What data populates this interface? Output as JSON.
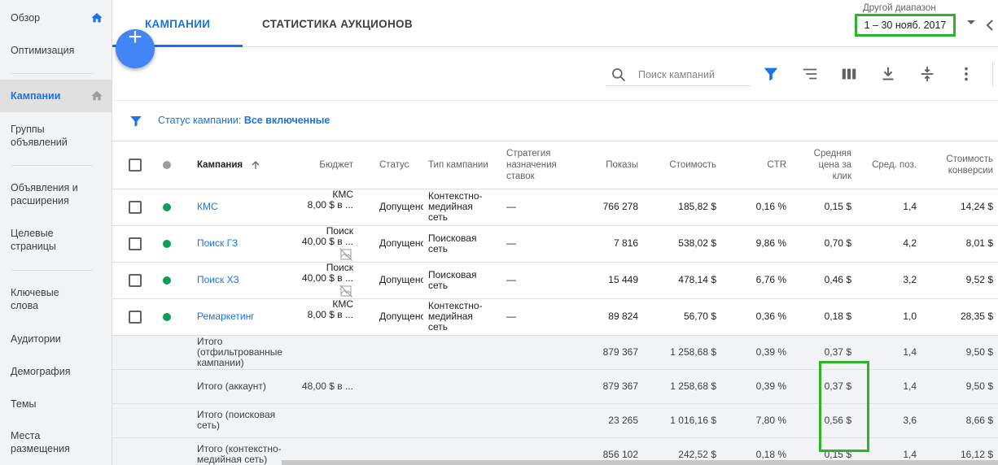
{
  "sidebar": {
    "items": [
      {
        "label": "Обзор"
      },
      {
        "label": "Оптимизация"
      },
      {
        "label": "Кампании"
      },
      {
        "label": "Группы объявлений"
      },
      {
        "label": "Объявления и расширения"
      },
      {
        "label": "Целевые страницы"
      },
      {
        "label": "Ключевые слова"
      },
      {
        "label": "Аудитории"
      },
      {
        "label": "Демография"
      },
      {
        "label": "Темы"
      },
      {
        "label": "Места размещения"
      }
    ]
  },
  "header": {
    "tabs": [
      {
        "label": "КАМПАНИИ"
      },
      {
        "label": "СТАТИСТИКА АУКЦИОНОВ"
      }
    ],
    "range_label": "Другой диапазон",
    "date_range": "1 – 30 нояб. 2017"
  },
  "fab": {
    "label": "+"
  },
  "toolbar": {
    "search_placeholder": "Поиск кампаний"
  },
  "filter": {
    "prefix": "Статус кампании: ",
    "value": "Все включенные"
  },
  "table": {
    "columns": {
      "campaign": "Кампания",
      "budget": "Бюджет",
      "status": "Статус",
      "type": "Тип кампании",
      "strategy": "Стратегия назначения ставок",
      "impressions": "Показы",
      "cost": "Стоимость",
      "ctr": "CTR",
      "avg_cpc": "Средняя цена за клик",
      "avg_pos": "Сред. поз.",
      "conv_cost": "Стоимость конверсии"
    },
    "rows": [
      {
        "name": "КМС",
        "budget_line1": "КМС",
        "budget_line2": "8,00 $ в ...",
        "status": "Допущено",
        "type": "Контекстно-медийная сеть",
        "strategy": "—",
        "impressions": "766 278",
        "cost": "185,82 $",
        "ctr": "0,16 %",
        "avg_cpc": "0,15 $",
        "avg_pos": "1,4",
        "conv_cost": "14,24 $"
      },
      {
        "name": "Поиск ГЗ",
        "budget_line1": "Поиск",
        "budget_line2": "40,00 $ в ...",
        "status": "Допущено",
        "type": "Поисковая сеть",
        "strategy": "—",
        "impressions": "7 816",
        "cost": "538,02 $",
        "ctr": "9,86 %",
        "avg_cpc": "0,70 $",
        "avg_pos": "4,2",
        "conv_cost": "8,01 $"
      },
      {
        "name": "Поиск ХЗ",
        "budget_line1": "Поиск",
        "budget_line2": "40,00 $ в ...",
        "status": "Допущено",
        "type": "Поисковая сеть",
        "strategy": "—",
        "impressions": "15 449",
        "cost": "478,14 $",
        "ctr": "6,76 %",
        "avg_cpc": "0,46 $",
        "avg_pos": "3,2",
        "conv_cost": "9,52 $"
      },
      {
        "name": "Ремаркетинг",
        "budget_line1": "КМС",
        "budget_line2": "8,00 $ в ...",
        "status": "Допущено",
        "type": "Контекстно-медийная сеть",
        "strategy": "—",
        "impressions": "89 824",
        "cost": "56,70 $",
        "ctr": "0,36 %",
        "avg_cpc": "0,18 $",
        "avg_pos": "1,0",
        "conv_cost": "28,35 $"
      }
    ],
    "totals": [
      {
        "label": "Итого (отфильтрованные кампании)",
        "budget": "",
        "impressions": "879 367",
        "cost": "1 258,68 $",
        "ctr": "0,39 %",
        "avg_cpc": "0,37 $",
        "avg_pos": "1,4",
        "conv_cost": "9,50 $"
      },
      {
        "label": "Итого (аккаунт)",
        "budget": "48,00 $ в ...",
        "impressions": "879 367",
        "cost": "1 258,68 $",
        "ctr": "0,39 %",
        "avg_cpc": "0,37 $",
        "avg_pos": "1,4",
        "conv_cost": "9,50 $"
      },
      {
        "label": "Итого (поисковая сеть)",
        "budget": "",
        "impressions": "23 265",
        "cost": "1 016,16 $",
        "ctr": "7,80 %",
        "avg_cpc": "0,56 $",
        "avg_pos": "3,6",
        "conv_cost": "8,66 $"
      },
      {
        "label": "Итого (контекстно-медийная сеть)",
        "budget": "",
        "impressions": "856 102",
        "cost": "242,52 $",
        "ctr": "0,18 %",
        "avg_cpc": "0,15 $",
        "avg_pos": "1,4",
        "conv_cost": "16,12 $"
      }
    ]
  },
  "colors": {
    "accent": "#1a73e8",
    "enabled_dot": "#0f9d58",
    "header_dot": "#9e9e9e",
    "highlight": "#2bb52b"
  },
  "icons": {
    "home": "home-icon",
    "search": "search-icon",
    "filter": "filter-icon",
    "segment": "segment-icon",
    "columns": "columns-icon",
    "download": "download-icon",
    "expand": "expand-icon",
    "more": "more-vert-icon",
    "no_image": "no-image-icon"
  }
}
